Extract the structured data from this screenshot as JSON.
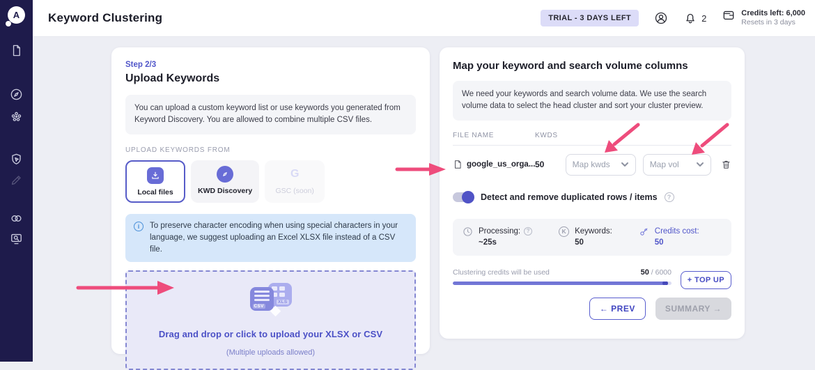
{
  "colors": {
    "accent": "#5156c9",
    "navy": "#1e1b4b",
    "annotation_pink": "#ee4c7c",
    "info_blue": "#4a90d9"
  },
  "header": {
    "page_title": "Keyword Clustering",
    "trial_badge": "TRIAL - 3 DAYS LEFT",
    "notification_count": "2",
    "credits_left": "Credits left: 6,000",
    "credits_resets": "Resets in 3 days"
  },
  "left_card": {
    "step": "Step 2/3",
    "title": "Upload Keywords",
    "description": "You can upload a custom keyword list or use keywords you generated from Keyword Discovery. You are allowed to combine multiple CSV files.",
    "source_label": "UPLOAD KEYWORDS FROM",
    "sources": [
      {
        "label": "Local files"
      },
      {
        "label": "KWD Discovery"
      },
      {
        "label": "GSC (soon)",
        "icon_letter": "G"
      }
    ],
    "info_icon_glyph": "i",
    "info_note": "To preserve character encoding when using special characters in your language, we suggest uploading an Excel XLSX file instead of a CSV file.",
    "dropzone": {
      "csv_label": "CSV",
      "xls_label": "XLS",
      "title": "Drag and drop or click to upload your XLSX or CSV",
      "subtitle": "(Multiple uploads allowed)"
    }
  },
  "right_card": {
    "title": "Map your keyword and search volume columns",
    "description": "We need your keywords and search volume data. We use the search volume data to select the head cluster and sort your cluster preview.",
    "table": {
      "col_file": "FILE NAME",
      "col_kwds": "KWDS",
      "row": {
        "file_name": "google_us_orga...",
        "kwds": "50",
        "map_kwds_placeholder": "Map kwds",
        "map_vol_placeholder": "Map vol"
      }
    },
    "toggle_label": "Detect and remove duplicated rows / items",
    "help_glyph": "?",
    "stats": {
      "processing_label": "Processing:",
      "processing_value": "~25s",
      "keywords_icon_letter": "K",
      "keywords_label": "Keywords:",
      "keywords_value": "50",
      "credits_label": "Credits cost:",
      "credits_value": "50"
    },
    "progress": {
      "label": "Clustering credits will be used",
      "used": "50",
      "total": " / 6000",
      "topup_label": "+ TOP UP"
    },
    "buttons": {
      "prev": "← PREV",
      "summary": "SUMMARY →"
    }
  }
}
